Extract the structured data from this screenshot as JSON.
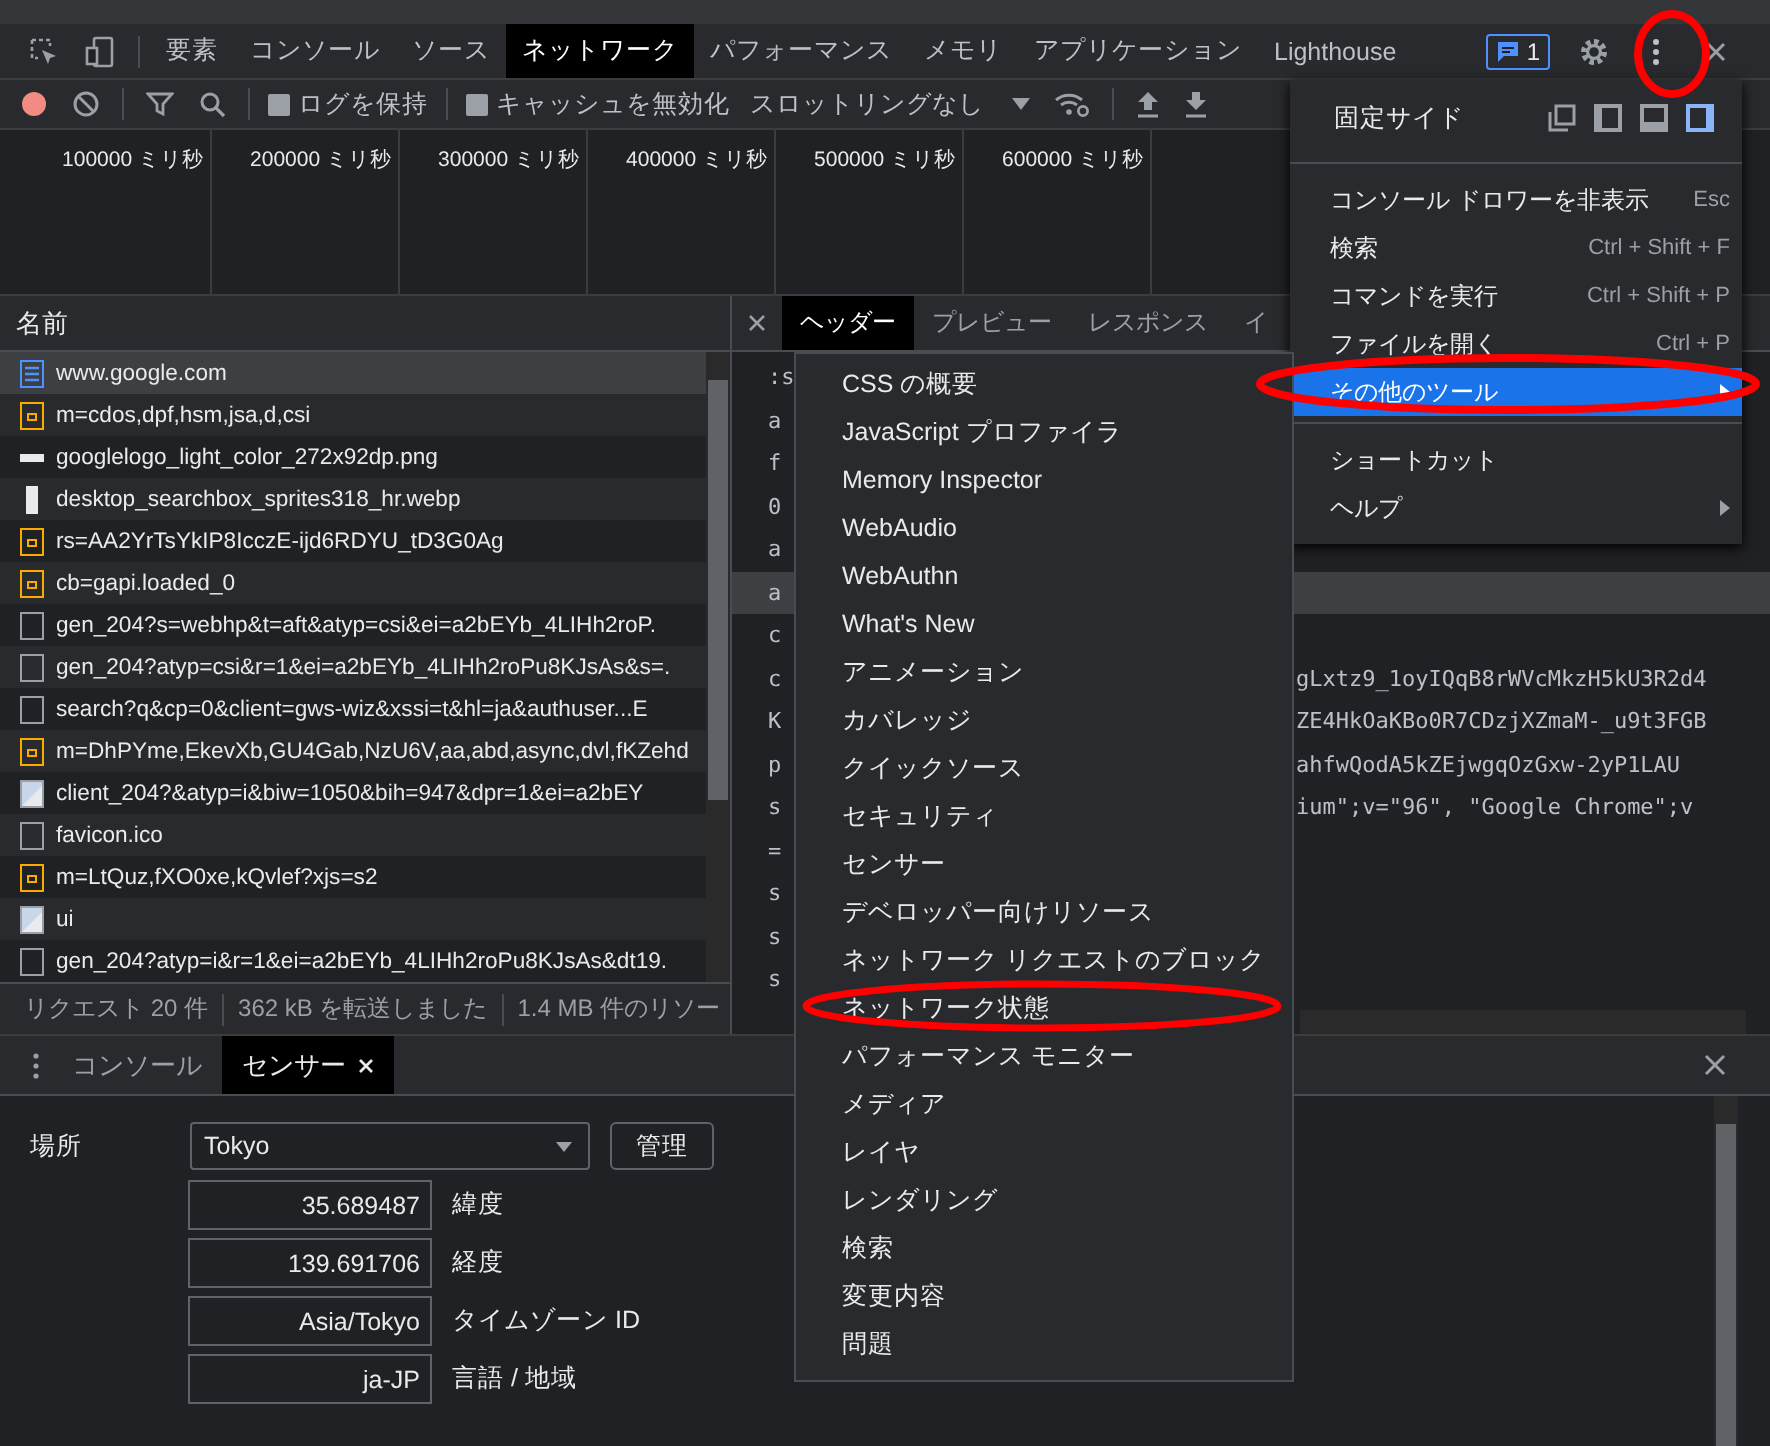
{
  "panel_tabs": [
    {
      "label": "要素",
      "selected": false
    },
    {
      "label": "コンソール",
      "selected": false
    },
    {
      "label": "ソース",
      "selected": false
    },
    {
      "label": "ネットワーク",
      "selected": true
    },
    {
      "label": "パフォーマンス",
      "selected": false
    },
    {
      "label": "メモリ",
      "selected": false
    },
    {
      "label": "アプリケーション",
      "selected": false
    },
    {
      "label": "Lighthouse",
      "selected": false
    }
  ],
  "issues_badge": "1",
  "toolbar": {
    "recording": true,
    "checkboxes": [
      {
        "label": "ログを保持",
        "checked": false
      },
      {
        "label": "キャッシュを無効化",
        "checked": false
      }
    ],
    "throttling": "スロットリングなし"
  },
  "overview_ticks": [
    "100000 ミリ秒",
    "200000 ミリ秒",
    "300000 ミリ秒",
    "400000 ミリ秒",
    "500000 ミリ秒",
    "600000 ミリ秒"
  ],
  "requests": {
    "column": "名前",
    "rows": [
      {
        "name": "www.google.com",
        "kind": "document",
        "selected": true
      },
      {
        "name": "m=cdos,dpf,hsm,jsa,d,csi",
        "kind": "script",
        "selected": false
      },
      {
        "name": "googlelogo_light_color_272x92dp.png",
        "kind": "image_wide",
        "selected": false
      },
      {
        "name": "desktop_searchbox_sprites318_hr.webp",
        "kind": "image_tall",
        "selected": false
      },
      {
        "name": "rs=AA2YrTsYkIP8IcczE-ijd6RDYU_tD3G0Ag",
        "kind": "script",
        "selected": false
      },
      {
        "name": "cb=gapi.loaded_0",
        "kind": "script",
        "selected": false
      },
      {
        "name": "gen_204?s=webhp&t=aft&atyp=csi&ei=a2bEYb_4LIHh2roP.",
        "kind": "other",
        "selected": false
      },
      {
        "name": "gen_204?atyp=csi&r=1&ei=a2bEYb_4LIHh2roPu8KJsAs&s=.",
        "kind": "other",
        "selected": false
      },
      {
        "name": "search?q&cp=0&client=gws-wiz&xssi=t&hl=ja&authuser...E",
        "kind": "other",
        "selected": false
      },
      {
        "name": "m=DhPYme,EkevXb,GU4Gab,NzU6V,aa,abd,async,dvl,fKZehd",
        "kind": "script",
        "selected": false
      },
      {
        "name": "client_204?&atyp=i&biw=1050&bih=947&dpr=1&ei=a2bEY",
        "kind": "image",
        "selected": false
      },
      {
        "name": "favicon.ico",
        "kind": "other",
        "selected": false
      },
      {
        "name": "m=LtQuz,fXO0xe,kQvlef?xjs=s2",
        "kind": "script",
        "selected": false
      },
      {
        "name": "ui",
        "kind": "image",
        "selected": false
      },
      {
        "name": "gen_204?atyp=i&r=1&ei=a2bEYb_4LIHh2roPu8KJsAs&dt19.",
        "kind": "other",
        "selected": false
      }
    ],
    "summary": [
      "リクエスト 20 件",
      "362 kB を転送しました",
      "1.4 MB 件のリソー"
    ]
  },
  "detail_tabs": [
    {
      "label": "ヘッダー",
      "selected": true
    },
    {
      "label": "プレビュー",
      "selected": false
    },
    {
      "label": "レスポンス",
      "selected": false
    },
    {
      "label": "イ",
      "selected": false
    }
  ],
  "header_lines": [
    {
      "name": ":s",
      "selected": false
    },
    {
      "name": "a",
      "selected": false
    },
    {
      "name": "f",
      "selected": false
    },
    {
      "name": "0",
      "selected": false
    },
    {
      "name": "a",
      "selected": false
    },
    {
      "name": "a",
      "selected": true
    },
    {
      "name": "c",
      "selected": false
    },
    {
      "name": "c",
      "value": "gLxtz9_1oyIQqB8rWVcMkzH5kU3R2d4",
      "selected": false
    },
    {
      "name": "K",
      "value": "ZE4HkOaKBo0R7CDzjXZmaM-_u9t3FGB",
      "selected": false
    },
    {
      "name": "p",
      "value": "ahfwQodA5kZEjwgqOzGxw-2yP1LAU",
      "selected": false
    },
    {
      "name": "s",
      "value": "ium\";v=\"96\", \"Google Chrome\";v",
      "selected": false
    },
    {
      "name": "=",
      "selected": false
    },
    {
      "name": "s",
      "selected": false
    },
    {
      "name": "s",
      "selected": false
    },
    {
      "name": "s",
      "selected": false
    }
  ],
  "main_menu": {
    "dock_label": "固定サイド",
    "dock_sides": [
      {
        "kind": "undock",
        "selected": false
      },
      {
        "kind": "left",
        "selected": false
      },
      {
        "kind": "bottom",
        "selected": false
      },
      {
        "kind": "right",
        "selected": true
      }
    ],
    "items": [
      {
        "label": "コンソール ドロワーを非表示",
        "shortcut": "Esc",
        "submenu": false,
        "selected": false
      },
      {
        "label": "検索",
        "shortcut": "Ctrl + Shift + F",
        "submenu": false,
        "selected": false
      },
      {
        "label": "コマンドを実行",
        "shortcut": "Ctrl + Shift + P",
        "submenu": false,
        "selected": false
      },
      {
        "label": "ファイルを開く",
        "shortcut": "Ctrl + P",
        "submenu": false,
        "selected": false
      },
      {
        "label": "その他のツール",
        "submenu": true,
        "selected": true
      },
      {
        "label": "ショートカット",
        "submenu": false,
        "selected": false
      },
      {
        "label": "ヘルプ",
        "submenu": true,
        "selected": false
      }
    ]
  },
  "more_tools": [
    "CSS の概要",
    "JavaScript プロファイラ",
    "Memory Inspector",
    "WebAudio",
    "WebAuthn",
    "What's New",
    "アニメーション",
    "カバレッジ",
    "クイックソース",
    "セキュリティ",
    "センサー",
    "デベロッパー向けリソース",
    "ネットワーク リクエストのブロック",
    "ネットワーク状態",
    "パフォーマンス モニター",
    "メディア",
    "レイヤ",
    "レンダリング",
    "検索",
    "変更内容",
    "問題"
  ],
  "drawer": {
    "tabs": [
      {
        "label": "コンソール",
        "selected": false,
        "closable": false
      },
      {
        "label": "センサー",
        "selected": true,
        "closable": true
      }
    ],
    "location": {
      "label": "場所",
      "value": "Tokyo",
      "button": "管理"
    },
    "fields": [
      {
        "value": "35.689487",
        "label": "緯度"
      },
      {
        "value": "139.691706",
        "label": "経度"
      },
      {
        "value": "Asia/Tokyo",
        "label": "タイムゾーン ID"
      },
      {
        "value": "ja-JP",
        "label": "言語 / 地域"
      }
    ]
  }
}
